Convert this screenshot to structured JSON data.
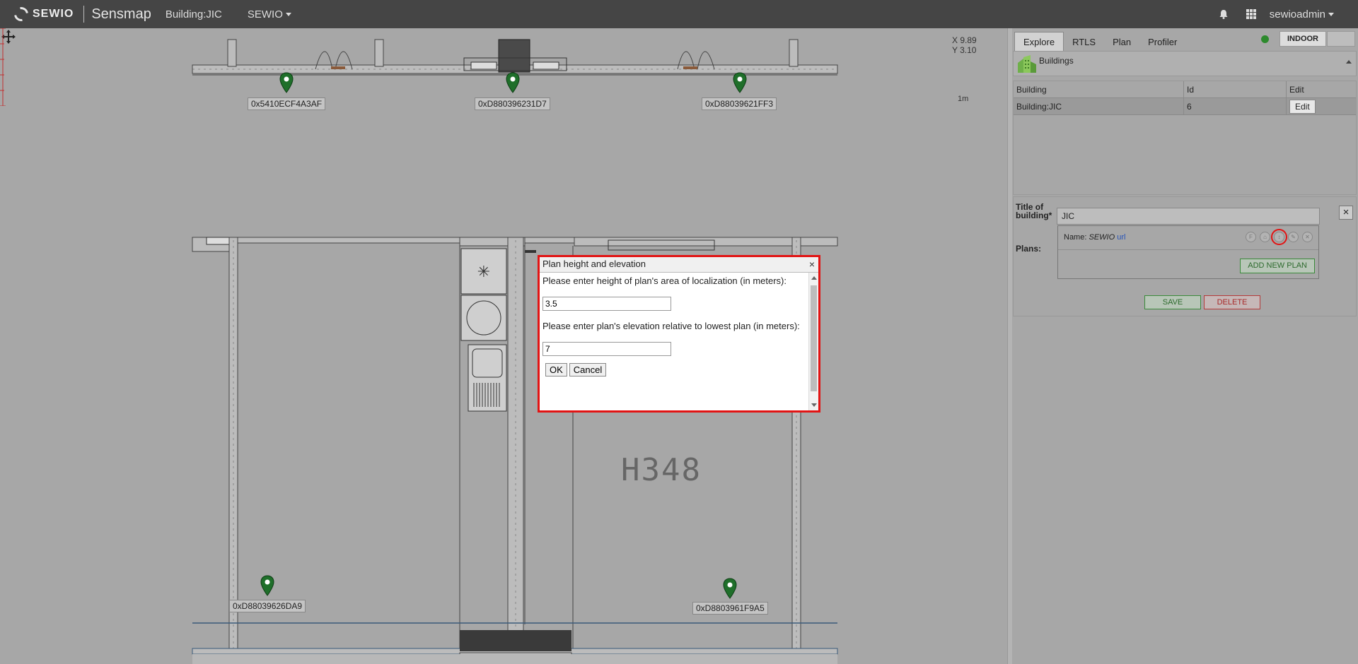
{
  "navbar": {
    "logo_text": "SEWIO",
    "app_name": "Sensmap",
    "building": "Building:JIC",
    "org": "SEWIO",
    "user": "sewioadmin"
  },
  "map": {
    "coord_x": "X 9.89",
    "coord_y": "Y 3.10",
    "scale_label": "1m",
    "room_label": "H348",
    "tags": [
      {
        "id": "0x5410ECF4A3AF"
      },
      {
        "id": "0xD880396231D7"
      },
      {
        "id": "0xD88039621FF3"
      },
      {
        "id": "0xD88039626DA9"
      },
      {
        "id": "0xD8803961F9A5"
      }
    ]
  },
  "panel": {
    "tabs": [
      "Explore",
      "RTLS",
      "Plan",
      "Profiler"
    ],
    "indoor_label": "INDOOR",
    "buildings_title": "Buildings",
    "table": {
      "headers": [
        "Building",
        "Id",
        "Edit"
      ],
      "rows": [
        {
          "building": "Building:JIC",
          "id": "6",
          "edit": "Edit"
        }
      ]
    },
    "form": {
      "title_label": "Title of building*",
      "title_value": "JIC",
      "close": "×",
      "plans_label": "Plans:",
      "plan_name_prefix": "Name:",
      "plan_name": "SEWIO",
      "plan_url": "url",
      "add_plan": "ADD NEW PLAN",
      "save": "SAVE",
      "delete": "DELETE"
    }
  },
  "modal": {
    "title": "Plan height and elevation",
    "close": "×",
    "height_prompt": "Please enter height of plan's area of localization (in meters):",
    "height_value": "3.5",
    "elevation_prompt": "Please enter plan's elevation relative to lowest plan (in meters):",
    "elevation_value": "7",
    "ok": "OK",
    "cancel": "Cancel"
  },
  "colors": {
    "navbar_bg": "#454545",
    "map_bg": "#a7a7a7",
    "pin_green": "#1f6f2a",
    "highlight_red": "#e21414"
  }
}
